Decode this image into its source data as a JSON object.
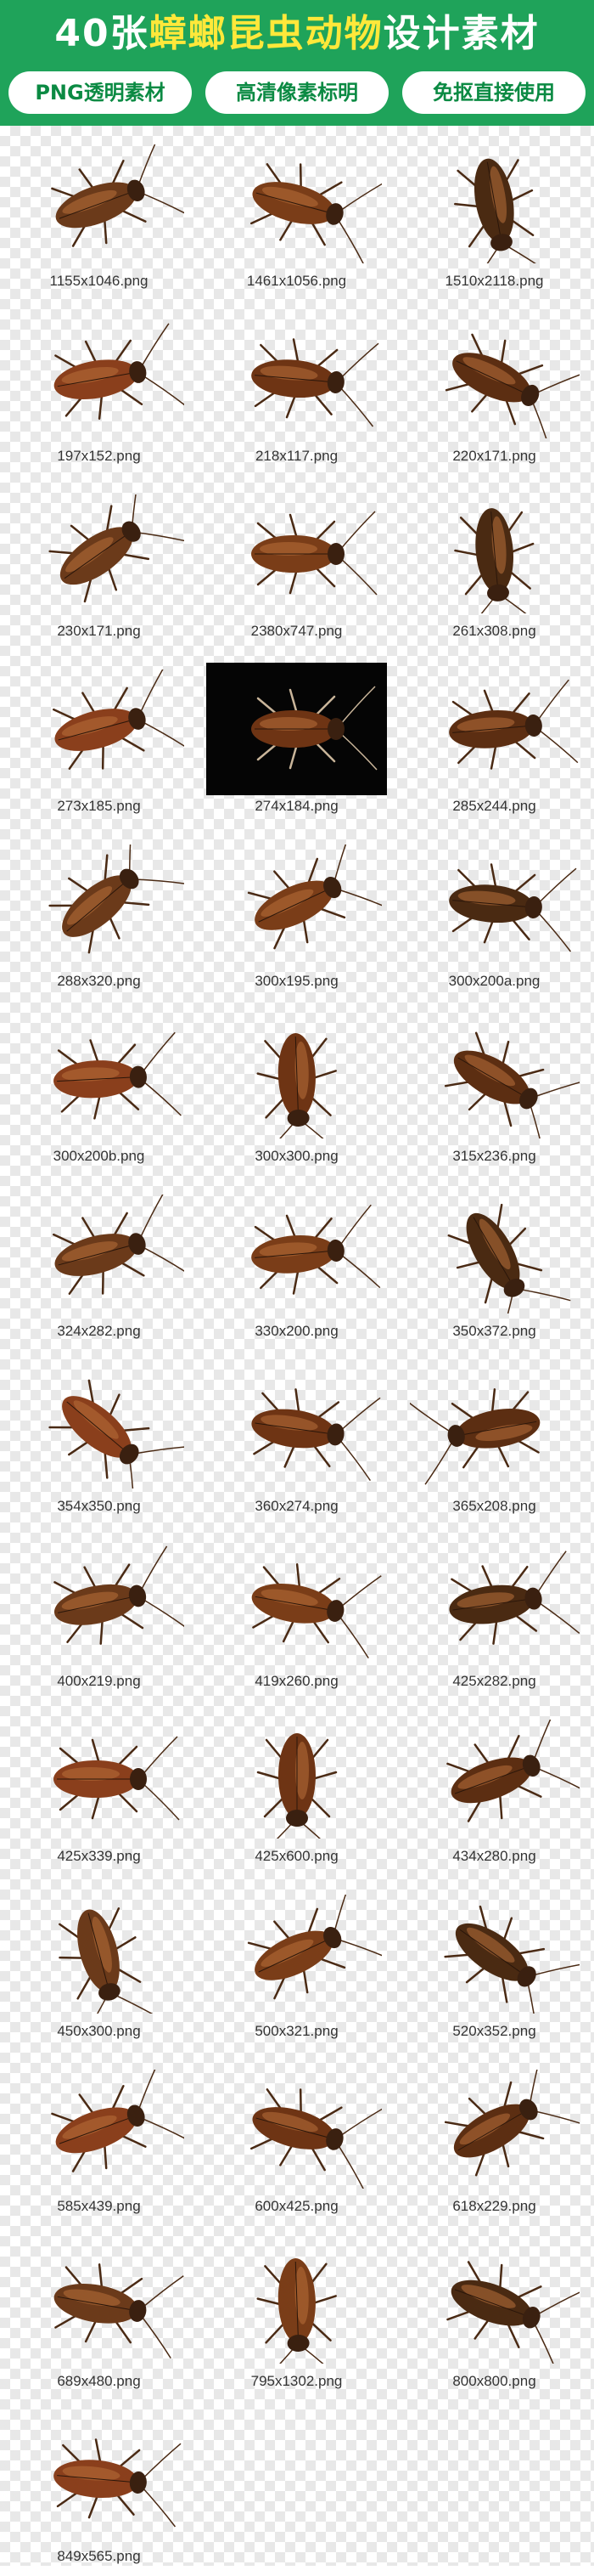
{
  "header": {
    "title_count": "40张",
    "title_main": "蟑螂昆虫动物",
    "title_suffix": "设计素材",
    "badges": [
      "PNG透明素材",
      "高清像素标明",
      "免抠直接使用"
    ]
  },
  "colors": {
    "header_green": "#1fa35a",
    "accent_yellow": "#ffe83a",
    "badge_text": "#0b8a43"
  },
  "items": [
    {
      "label": "1155x1046.png",
      "icon": "cockroach-icon"
    },
    {
      "label": "1461x1056.png",
      "icon": "cockroach-icon"
    },
    {
      "label": "1510x2118.png",
      "icon": "cockroach-icon"
    },
    {
      "label": "197x152.png",
      "icon": "cockroach-icon"
    },
    {
      "label": "218x117.png",
      "icon": "cockroach-icon"
    },
    {
      "label": "220x171.png",
      "icon": "cockroach-icon"
    },
    {
      "label": "230x171.png",
      "icon": "cockroach-icon"
    },
    {
      "label": "2380x747.png",
      "icon": "cockroach-icon"
    },
    {
      "label": "261x308.png",
      "icon": "cockroach-icon"
    },
    {
      "label": "273x185.png",
      "icon": "cockroach-icon"
    },
    {
      "label": "274x184.png",
      "icon": "cockroach-icon",
      "dark": true
    },
    {
      "label": "285x244.png",
      "icon": "cockroach-icon"
    },
    {
      "label": "288x320.png",
      "icon": "cockroach-icon"
    },
    {
      "label": "300x195.png",
      "icon": "cockroach-icon"
    },
    {
      "label": "300x200a.png",
      "icon": "cockroach-icon"
    },
    {
      "label": "300x200b.png",
      "icon": "cockroach-icon"
    },
    {
      "label": "300x300.png",
      "icon": "cockroach-icon"
    },
    {
      "label": "315x236.png",
      "icon": "cockroach-icon"
    },
    {
      "label": "324x282.png",
      "icon": "cockroach-icon"
    },
    {
      "label": "330x200.png",
      "icon": "cockroach-icon"
    },
    {
      "label": "350x372.png",
      "icon": "cockroach-icon"
    },
    {
      "label": "354x350.png",
      "icon": "cockroach-icon"
    },
    {
      "label": "360x274.png",
      "icon": "cockroach-icon"
    },
    {
      "label": "365x208.png",
      "icon": "cockroach-icon"
    },
    {
      "label": "400x219.png",
      "icon": "cockroach-icon"
    },
    {
      "label": "419x260.png",
      "icon": "cockroach-icon"
    },
    {
      "label": "425x282.png",
      "icon": "cockroach-icon"
    },
    {
      "label": "425x339.png",
      "icon": "cockroach-icon"
    },
    {
      "label": "425x600.png",
      "icon": "cockroach-icon"
    },
    {
      "label": "434x280.png",
      "icon": "cockroach-icon"
    },
    {
      "label": "450x300.png",
      "icon": "cockroach-icon"
    },
    {
      "label": "500x321.png",
      "icon": "cockroach-icon"
    },
    {
      "label": "520x352.png",
      "icon": "cockroach-icon"
    },
    {
      "label": "585x439.png",
      "icon": "cockroach-icon"
    },
    {
      "label": "600x425.png",
      "icon": "cockroach-icon"
    },
    {
      "label": "618x229.png",
      "icon": "cockroach-icon"
    },
    {
      "label": "689x480.png",
      "icon": "cockroach-icon"
    },
    {
      "label": "795x1302.png",
      "icon": "cockroach-icon"
    },
    {
      "label": "800x800.png",
      "icon": "cockroach-icon"
    },
    {
      "label": "849x565.png",
      "icon": "cockroach-icon"
    }
  ]
}
